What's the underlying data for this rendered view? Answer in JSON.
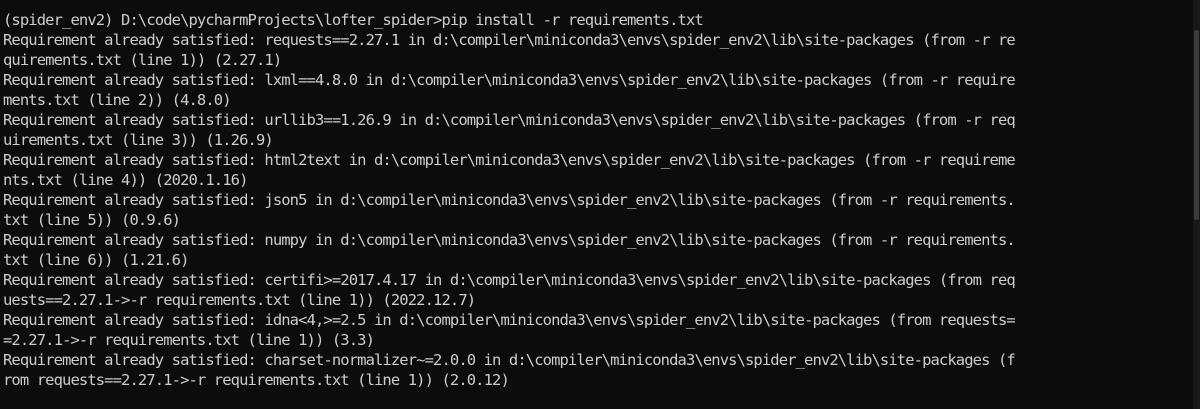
{
  "terminal": {
    "lines": [
      "(spider_env2) D:\\code\\pycharmProjects\\lofter_spider>pip install -r requirements.txt",
      "Requirement already satisfied: requests==2.27.1 in d:\\compiler\\miniconda3\\envs\\spider_env2\\lib\\site-packages (from -r re",
      "quirements.txt (line 1)) (2.27.1)",
      "Requirement already satisfied: lxml==4.8.0 in d:\\compiler\\miniconda3\\envs\\spider_env2\\lib\\site-packages (from -r require",
      "ments.txt (line 2)) (4.8.0)",
      "Requirement already satisfied: urllib3==1.26.9 in d:\\compiler\\miniconda3\\envs\\spider_env2\\lib\\site-packages (from -r req",
      "uirements.txt (line 3)) (1.26.9)",
      "Requirement already satisfied: html2text in d:\\compiler\\miniconda3\\envs\\spider_env2\\lib\\site-packages (from -r requireme",
      "nts.txt (line 4)) (2020.1.16)",
      "Requirement already satisfied: json5 in d:\\compiler\\miniconda3\\envs\\spider_env2\\lib\\site-packages (from -r requirements.",
      "txt (line 5)) (0.9.6)",
      "Requirement already satisfied: numpy in d:\\compiler\\miniconda3\\envs\\spider_env2\\lib\\site-packages (from -r requirements.",
      "txt (line 6)) (1.21.6)",
      "Requirement already satisfied: certifi>=2017.4.17 in d:\\compiler\\miniconda3\\envs\\spider_env2\\lib\\site-packages (from req",
      "uests==2.27.1->-r requirements.txt (line 1)) (2022.12.7)",
      "Requirement already satisfied: idna<4,>=2.5 in d:\\compiler\\miniconda3\\envs\\spider_env2\\lib\\site-packages (from requests=",
      "=2.27.1->-r requirements.txt (line 1)) (3.3)",
      "Requirement already satisfied: charset-normalizer~=2.0.0 in d:\\compiler\\miniconda3\\envs\\spider_env2\\lib\\site-packages (f",
      "rom requests==2.27.1->-r requirements.txt (line 1)) (2.0.12)"
    ]
  },
  "colors": {
    "background": "#0c0c0c",
    "text": "#cccccc",
    "scrollbar_track": "#17171a",
    "scrollbar_thumb": "#3a3a3d"
  }
}
